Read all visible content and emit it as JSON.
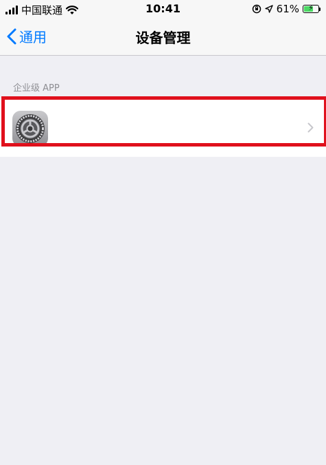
{
  "status_bar": {
    "carrier": "中国联通",
    "time": "10:41",
    "battery_percent": "61%",
    "signal_bars": 4,
    "icons": [
      "signal-icon",
      "wifi-icon",
      "orientation-lock-icon",
      "location-icon",
      "battery-charging-icon"
    ]
  },
  "nav": {
    "back_label": "通用",
    "title": "设备管理"
  },
  "section": {
    "header": "企业级 APP",
    "items": [
      {
        "icon": "settings-gear-icon",
        "label": ""
      }
    ]
  },
  "colors": {
    "accent": "#007aff",
    "highlight": "#e0101c",
    "background": "#efeff4"
  }
}
